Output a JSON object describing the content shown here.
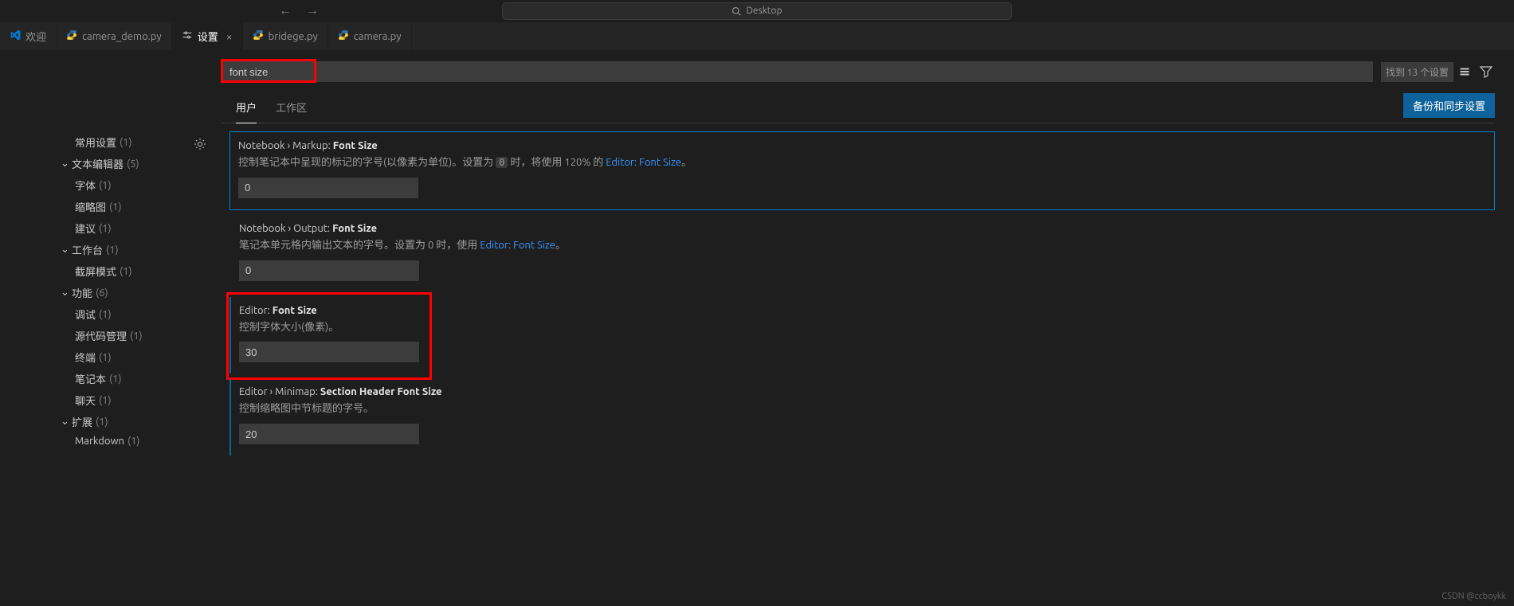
{
  "titlebar": {
    "search_label": "Desktop"
  },
  "tabs": [
    {
      "label": "欢迎",
      "icon": "vscode"
    },
    {
      "label": "camera_demo.py",
      "icon": "python"
    },
    {
      "label": "设置",
      "icon": "settings",
      "active": true,
      "closeable": true
    },
    {
      "label": "bridege.py",
      "icon": "python"
    },
    {
      "label": "camera.py",
      "icon": "python"
    }
  ],
  "search": {
    "value": "font size",
    "count_label": "找到 13 个设置"
  },
  "scope": {
    "user": "用户",
    "workspace": "工作区",
    "sync_button": "备份和同步设置"
  },
  "toc": [
    {
      "label": "常用设置",
      "count": "(1)",
      "indent": 1
    },
    {
      "label": "文本编辑器",
      "count": "(5)",
      "chev": true,
      "indent": 0
    },
    {
      "label": "字体",
      "count": "(1)",
      "indent": 1
    },
    {
      "label": "缩略图",
      "count": "(1)",
      "indent": 1
    },
    {
      "label": "建议",
      "count": "(1)",
      "indent": 1
    },
    {
      "label": "工作台",
      "count": "(1)",
      "chev": true,
      "indent": 0
    },
    {
      "label": "截屏模式",
      "count": "(1)",
      "indent": 1
    },
    {
      "label": "功能",
      "count": "(6)",
      "chev": true,
      "indent": 0
    },
    {
      "label": "调试",
      "count": "(1)",
      "indent": 1
    },
    {
      "label": "源代码管理",
      "count": "(1)",
      "indent": 1
    },
    {
      "label": "终端",
      "count": "(1)",
      "indent": 1
    },
    {
      "label": "笔记本",
      "count": "(1)",
      "indent": 1
    },
    {
      "label": "聊天",
      "count": "(1)",
      "indent": 1
    },
    {
      "label": "扩展",
      "count": "(1)",
      "chev": true,
      "indent": 0
    },
    {
      "label": "Markdown",
      "count": "(1)",
      "indent": 1
    }
  ],
  "settings": [
    {
      "breadcrumb": "Notebook › Markup: ",
      "title": "Font Size",
      "desc_pre": "控制笔记本中呈现的标记的字号(以像素为单位)。设置为 ",
      "desc_code": "0",
      "desc_mid": " 时，将使用 120% 的 ",
      "desc_link": "Editor: Font Size",
      "desc_post": "。",
      "value": "0",
      "selected": true,
      "gear": true
    },
    {
      "breadcrumb": "Notebook › Output: ",
      "title": "Font Size",
      "desc_pre": "笔记本单元格内输出文本的字号。设置为 0 时，使用 ",
      "desc_link": "Editor: Font Size",
      "desc_post": "。",
      "value": "0"
    },
    {
      "breadcrumb": "Editor: ",
      "title": "Font Size",
      "desc_pre": "控制字体大小(像素)。",
      "value": "30",
      "modified": true,
      "highlight": true
    },
    {
      "breadcrumb": "Editor › Minimap: ",
      "title": "Section Header Font Size",
      "desc_pre": "控制缩略图中节标题的字号。",
      "value": "20",
      "modified": true
    }
  ],
  "watermark": "CSDN @ccboykk"
}
